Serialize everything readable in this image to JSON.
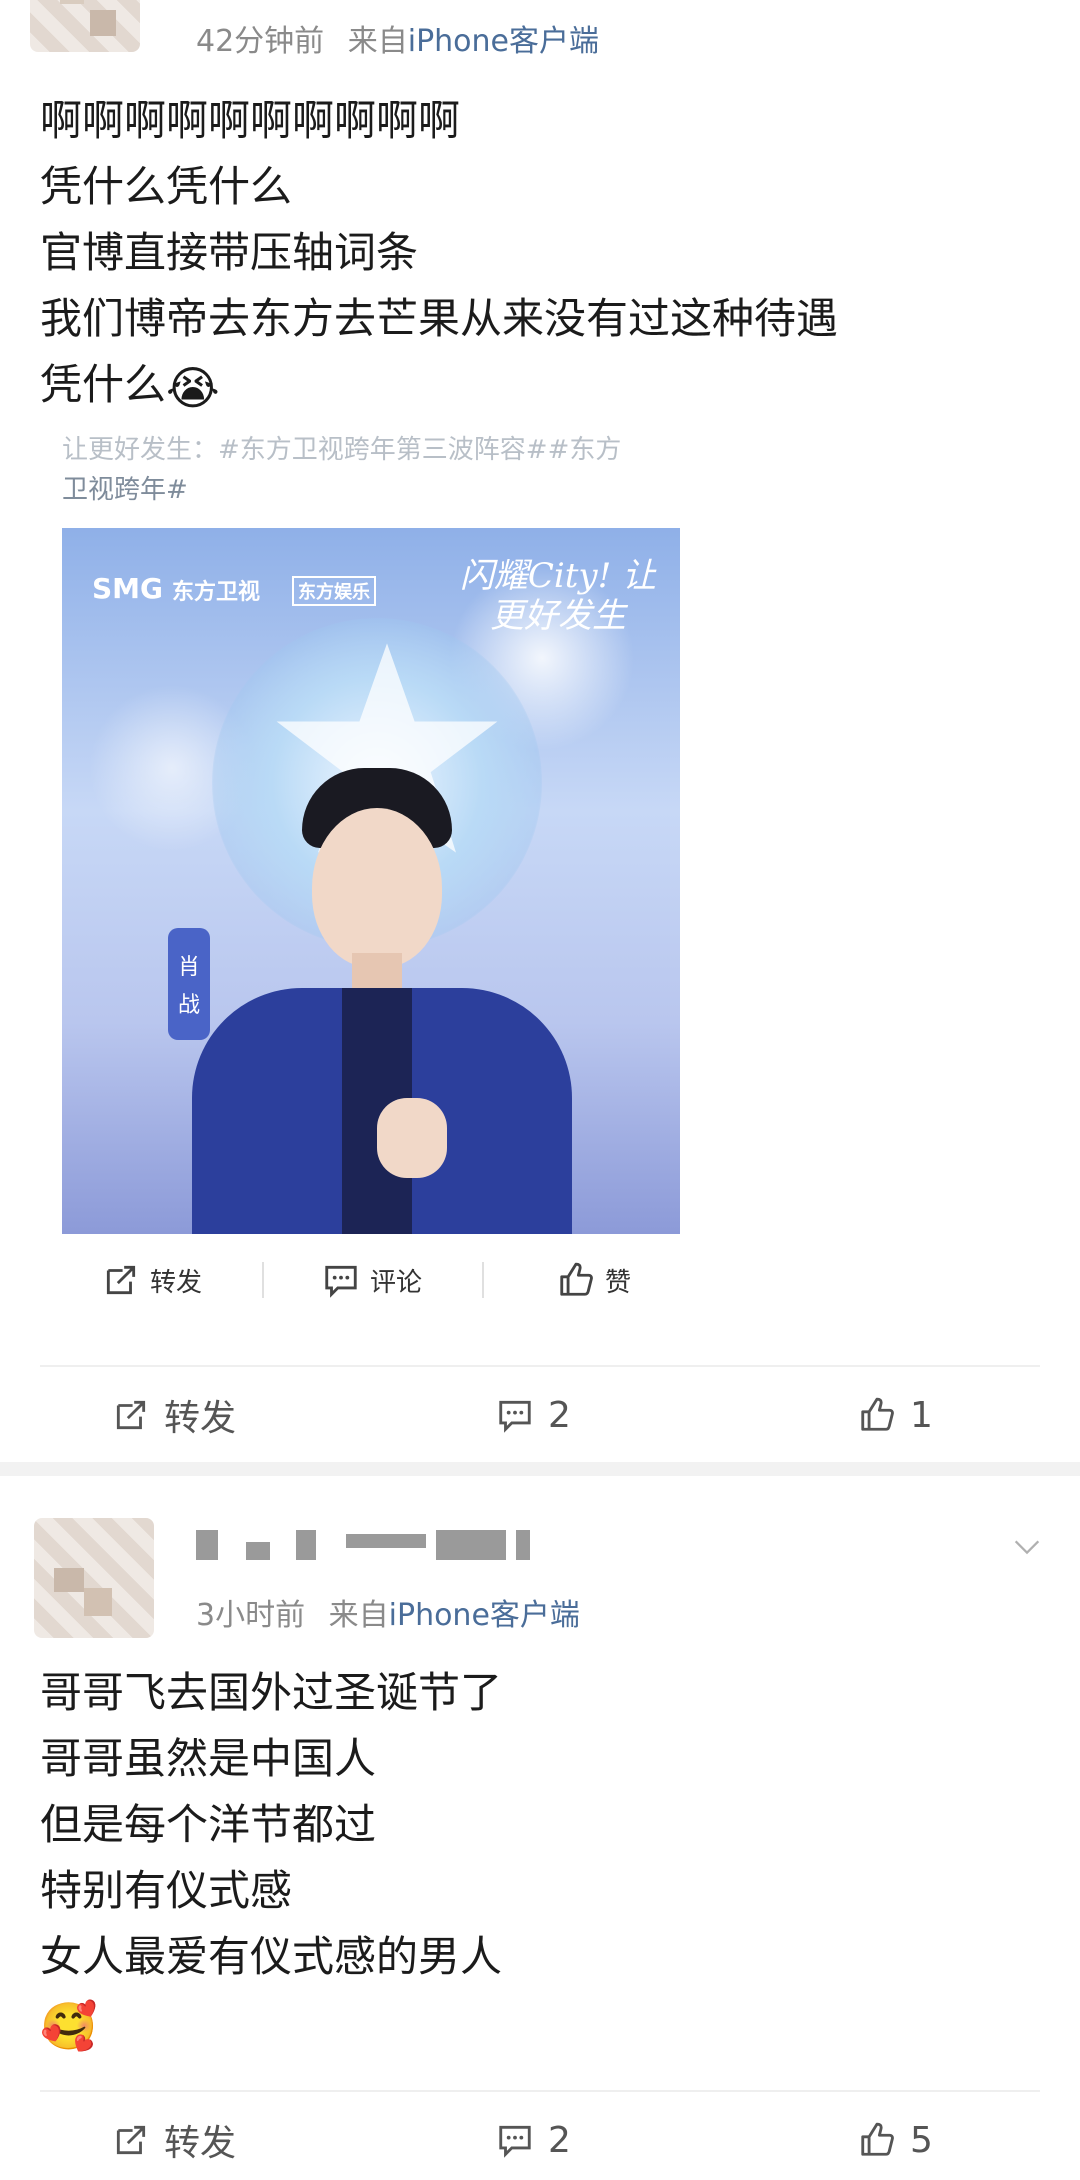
{
  "posts": [
    {
      "time": "42分钟前",
      "source_prefix": "来自",
      "source": "iPhone客户端",
      "lines": [
        "啊啊啊啊啊啊啊啊啊啊",
        "凭什么凭什么",
        "官博直接带压轴词条",
        "我们博帝去东方去芒果从来没有过这种待遇",
        "凭什么"
      ],
      "emoji": "😭",
      "embedded": {
        "text_line1": "让更好发生：#东方卫视跨年第三波阵容##东方",
        "text_line2": "卫视跨年#",
        "poster": {
          "logo_smg": "SMG",
          "logo_dongfang": "东方卫视",
          "logo_ent": "东方娱乐",
          "slogan": "闪耀City! 让更好发生",
          "name_tag": [
            "肖",
            "战"
          ]
        },
        "actions": {
          "repost": "转发",
          "comment": "评论",
          "like": "赞"
        }
      },
      "actions": {
        "repost": "转发",
        "comment_count": "2",
        "like_count": "1"
      }
    },
    {
      "time": "3小时前",
      "source_prefix": "来自",
      "source": "iPhone客户端",
      "lines": [
        "哥哥飞去国外过圣诞节了",
        "哥哥虽然是中国人",
        "但是每个洋节都过",
        "特别有仪式感",
        "女人最爱有仪式感的男人"
      ],
      "emoji": "🥰",
      "actions": {
        "repost": "转发",
        "comment_count": "2",
        "like_count": "5"
      }
    }
  ],
  "colors": {
    "meta": "#8a8a8a",
    "source": "#4a6d99",
    "divider": "#efefef"
  }
}
